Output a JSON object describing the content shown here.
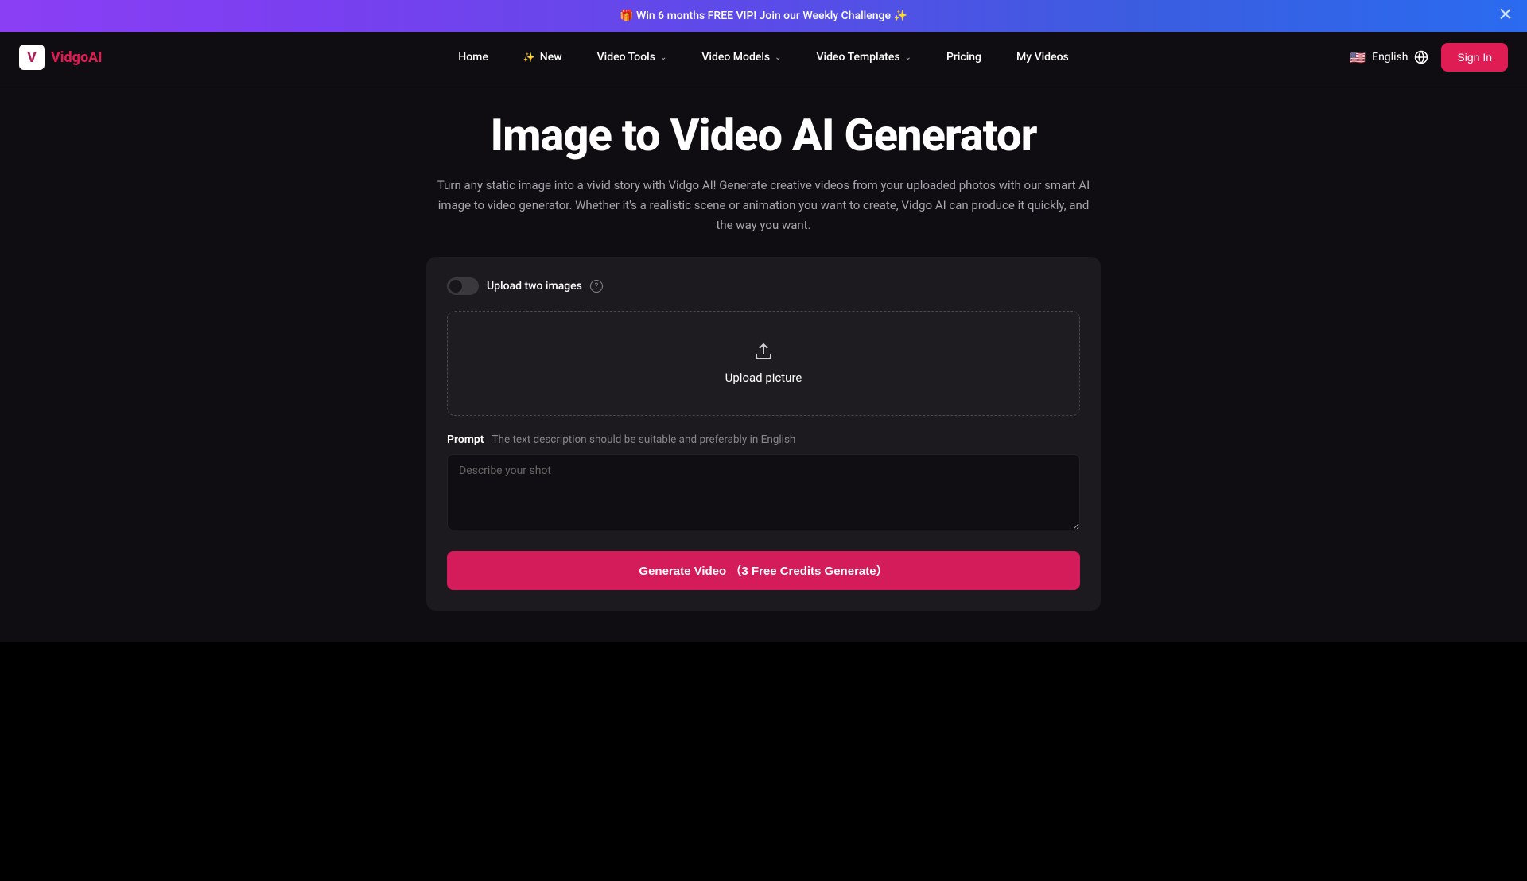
{
  "banner": {
    "text": "🎁 Win 6 months FREE VIP! Join our Weekly Challenge ✨"
  },
  "logo": {
    "icon": "V",
    "text": "VidgoAI"
  },
  "nav": {
    "home": "Home",
    "new": "New",
    "video_tools": "Video Tools",
    "video_models": "Video Models",
    "video_templates": "Video Templates",
    "pricing": "Pricing",
    "my_videos": "My Videos"
  },
  "header_right": {
    "language": "English",
    "flag": "🇺🇸",
    "signin": "Sign In"
  },
  "main": {
    "title": "Image to Video AI Generator",
    "subtitle": "Turn any static image into a vivid story with Vidgo AI! Generate creative videos from your uploaded photos with our smart AI image to video generator. Whether it's a realistic scene or animation you want to create, Vidgo AI can produce it quickly, and the way you want."
  },
  "card": {
    "toggle_label": "Upload two images",
    "upload_text": "Upload picture",
    "prompt_label": "Prompt",
    "prompt_hint": "The text description should be suitable and preferably in English",
    "prompt_placeholder": "Describe your shot",
    "generate_button": "Generate Video （3 Free Credits Generate）"
  }
}
